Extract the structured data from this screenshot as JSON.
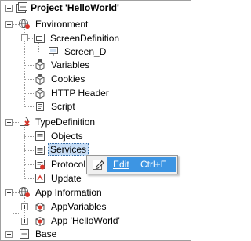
{
  "tree": {
    "root_label": "Project 'HelloWorld'",
    "environment": {
      "label": "Environment",
      "screen_definition": "ScreenDefinition",
      "screen_d": "Screen_D",
      "variables": "Variables",
      "cookies": "Cookies",
      "http_header": "HTTP Header",
      "script": "Script"
    },
    "type_definition": {
      "label": "TypeDefinition",
      "objects": "Objects",
      "services": "Services",
      "protocol": "Protocol",
      "update": "Update"
    },
    "app_information": {
      "label": "App Information",
      "app_variables": "AppVariables",
      "app_helloworld": "App 'HelloWorld'"
    },
    "base": "Base"
  },
  "context_menu": {
    "edit_label": "Edit",
    "edit_shortcut": "Ctrl+E"
  },
  "colors": {
    "selection": "#c9dff7",
    "menu_highlight": "#3d95e3",
    "icon_red": "#d9362b",
    "icon_gray": "#555555"
  }
}
